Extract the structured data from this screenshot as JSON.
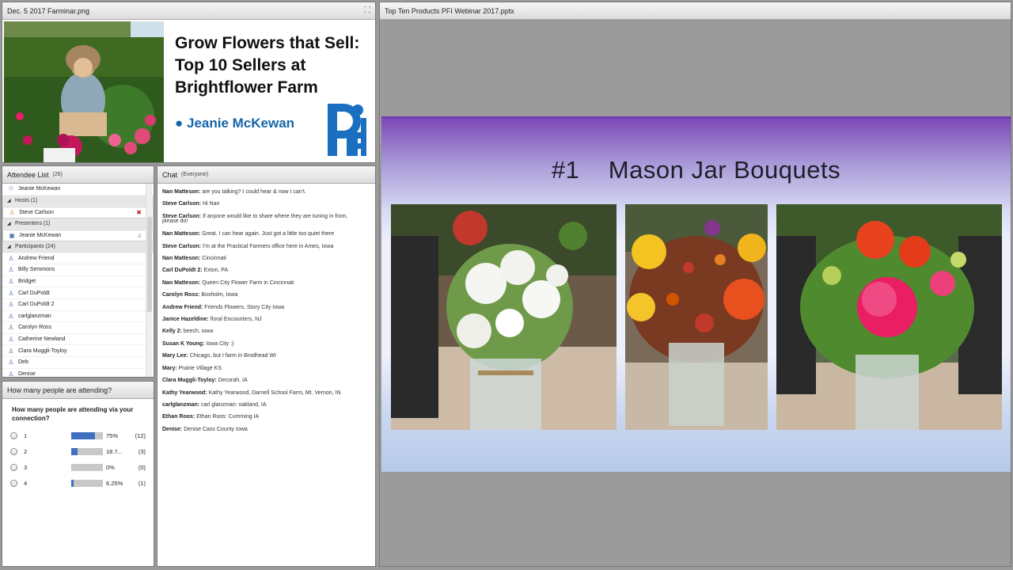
{
  "share_pod": {
    "title": "Dec. 5 2017 Farminar.png"
  },
  "banner": {
    "heading": [
      "Grow Flowers that Sell:",
      "Top 10 Sellers at",
      "Brightflower Farm"
    ],
    "presenter": "● Jeanie McKewan",
    "logo_text": "PFI",
    "colors": {
      "heading": "#111111",
      "presenter": "#1565a8",
      "logo": "#1a6fc0"
    }
  },
  "attendee_pod": {
    "title": "Attendee List",
    "count": "(26)",
    "me": "Jeanie McKewan",
    "groups": [
      {
        "label": "Hosts (1)",
        "members": [
          "Steve Carlson"
        ]
      },
      {
        "label": "Presenters (1)",
        "members": [
          "Jeanie McKewan"
        ]
      },
      {
        "label": "Participants (24)",
        "members": [
          "Andrew Friend",
          "Billy Semmons",
          "Bridget",
          "Carl DuPoldt",
          "Carl DuPoldt 2",
          "carlglanzman",
          "Carolyn Ross",
          "Catherine Newland",
          "Clara Muggli-Toyloy",
          "Deb",
          "Denise"
        ]
      }
    ]
  },
  "poll_pod": {
    "title": "How many people are attending?",
    "question": "How many people are attending via your connection?",
    "options": [
      {
        "label": "1",
        "percent": 75,
        "percent_text": "75%",
        "count": "(12)"
      },
      {
        "label": "2",
        "percent": 18.75,
        "percent_text": "18.7...",
        "count": "(3)"
      },
      {
        "label": "3",
        "percent": 0,
        "percent_text": "0%",
        "count": "(0)"
      },
      {
        "label": "4",
        "percent": 6.25,
        "percent_text": "6.25%",
        "count": "(1)"
      }
    ]
  },
  "chat_pod": {
    "title": "Chat",
    "scope": "(Everyone)",
    "messages": [
      {
        "from": "Nan Matteson:",
        "text": "are you talking? I could hear & now I can't."
      },
      {
        "from": "Steve Carlson:",
        "text": "Hi Nan"
      },
      {
        "from": "Steve Carlson:",
        "text": "If anyone would like to share where they are tuning in from,"
      },
      {
        "from": "",
        "text": "please do!"
      },
      {
        "from": "Nan Matteson:",
        "text": "Great. I can hear again. Just got a little too quiet there"
      },
      {
        "from": "Steve Carlson:",
        "text": "I'm at the Practical Farmers office here in Ames, Iowa"
      },
      {
        "from": "Nan Matteson:",
        "text": "Cincinnati"
      },
      {
        "from": "Carl DuPoldt 2:",
        "text": "Exton, PA"
      },
      {
        "from": "Nan Matteson:",
        "text": "Queen City Flower Farm in Cincinnati"
      },
      {
        "from": "Carolyn Ross:",
        "text": "Boxholm, Iowa"
      },
      {
        "from": "Andrew Friend:",
        "text": "Friends Flowers, Story City Iowa"
      },
      {
        "from": "Janice Hazeldine:",
        "text": "floral Encounters, NJ"
      },
      {
        "from": "Kelly 2:",
        "text": "beech, iowa"
      },
      {
        "from": "Susan K Young:",
        "text": "Iowa City :)"
      },
      {
        "from": "Mary Lee:",
        "text": "Chicago, but I farm in Brodhead WI"
      },
      {
        "from": "Mary:",
        "text": "Prairie Village KS"
      },
      {
        "from": "Clara Muggli-Toyloy:",
        "text": "Decorah, IA"
      },
      {
        "from": "Kathy Yearwood:",
        "text": "Kathy Yearwood, Darnell School Farm, Mt. Vernon, IN"
      },
      {
        "from": "carlglanzman:",
        "text": "carl glanzman: oakland, IA"
      },
      {
        "from": "Ethan Roos:",
        "text": "Ethan Roos: Cumming IA"
      },
      {
        "from": "Denise:",
        "text": "Denise Cass County Iowa"
      }
    ]
  },
  "slide_pod": {
    "title": "Top Ten Products PFI Webinar 2017.pptx",
    "slide_title": "#1    Mason Jar Bouquets"
  }
}
